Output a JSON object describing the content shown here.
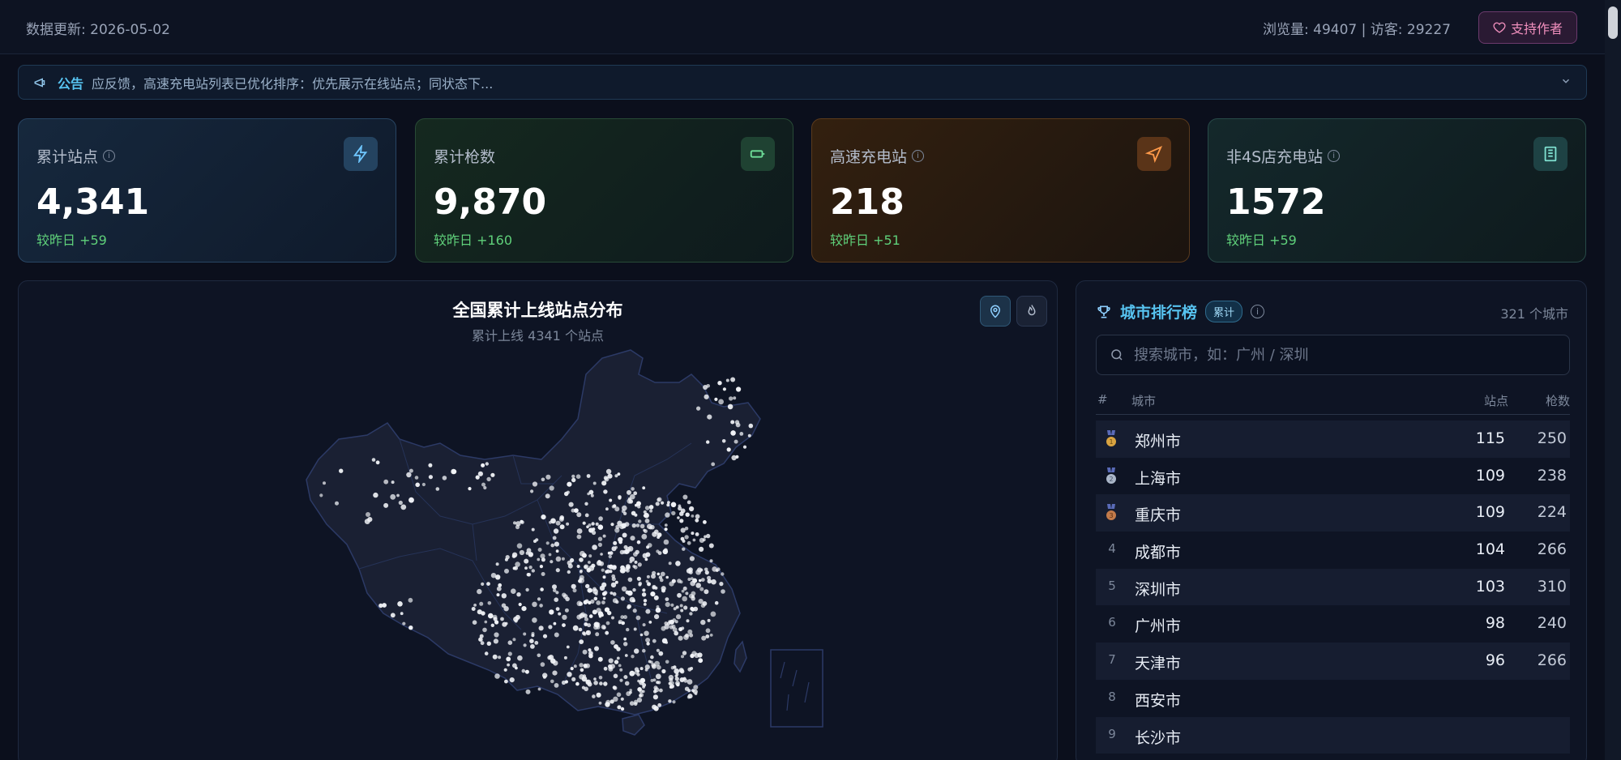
{
  "topbar": {
    "update_text": "数据更新: 2026-05-02",
    "visit_stats": "浏览量: 49407 | 访客: 29227",
    "support_label": "支持作者"
  },
  "announcement": {
    "tag": "公告",
    "text": "应反馈，高速充电站列表已优化排序：优先展示在线站点；同状态下..."
  },
  "stats": [
    {
      "label": "累计站点",
      "value": "4,341",
      "delta": "较昨日 +59",
      "icon": "bolt-icon"
    },
    {
      "label": "累计枪数",
      "value": "9,870",
      "delta": "较昨日 +160",
      "icon": "battery-icon"
    },
    {
      "label": "高速充电站",
      "value": "218",
      "delta": "较昨日 +51",
      "icon": "navigation-icon"
    },
    {
      "label": "非4S店充电站",
      "value": "1572",
      "delta": "较昨日 +59",
      "icon": "building-icon"
    }
  ],
  "map": {
    "title": "全国累计上线站点分布",
    "subtitle": "累计上线 4341 个站点"
  },
  "ranking": {
    "title": "城市排行榜",
    "pill": "累计",
    "count": "321 个城市",
    "search_placeholder": "搜索城市，如：广州 / 深圳",
    "headers": {
      "rank": "#",
      "city": "城市",
      "stations": "站点",
      "guns": "枪数"
    },
    "rows": [
      {
        "rank": "1",
        "city": "郑州市",
        "stations": "115",
        "guns": "250"
      },
      {
        "rank": "2",
        "city": "上海市",
        "stations": "109",
        "guns": "238"
      },
      {
        "rank": "3",
        "city": "重庆市",
        "stations": "109",
        "guns": "224"
      },
      {
        "rank": "4",
        "city": "成都市",
        "stations": "104",
        "guns": "266"
      },
      {
        "rank": "5",
        "city": "深圳市",
        "stations": "103",
        "guns": "310"
      },
      {
        "rank": "6",
        "city": "广州市",
        "stations": "98",
        "guns": "240"
      },
      {
        "rank": "7",
        "city": "天津市",
        "stations": "96",
        "guns": "266"
      },
      {
        "rank": "8",
        "city": "西安市",
        "stations": "",
        "guns": ""
      },
      {
        "rank": "9",
        "city": "长沙市",
        "stations": "",
        "guns": ""
      }
    ]
  },
  "colors": {
    "accent": "#57c3f0",
    "positive": "#5fd07a",
    "support": "#f08fbd",
    "gold": "#d9a441",
    "silver": "#aab6c8",
    "bronze": "#c27a4a"
  }
}
